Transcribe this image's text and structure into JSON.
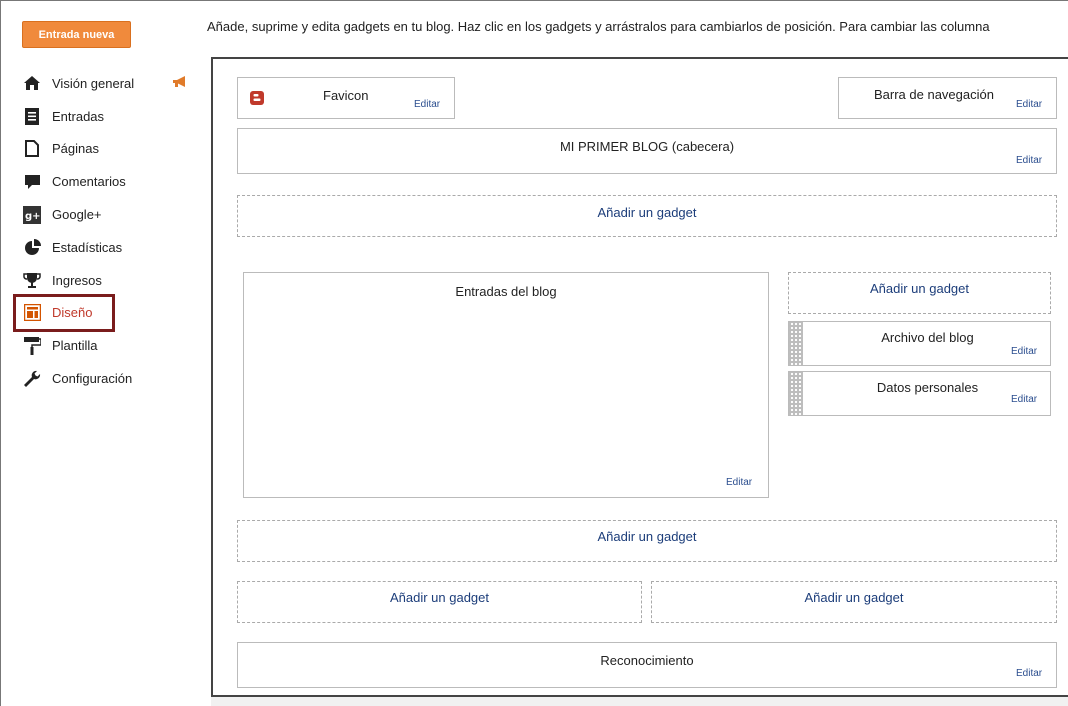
{
  "sidebar": {
    "new_post_label": "Entrada nueva",
    "items": [
      {
        "label": "Visión general",
        "icon": "home-icon"
      },
      {
        "label": "Entradas",
        "icon": "posts-icon"
      },
      {
        "label": "Páginas",
        "icon": "pages-icon"
      },
      {
        "label": "Comentarios",
        "icon": "comment-icon"
      },
      {
        "label": "Google+",
        "icon": "google-plus-icon"
      },
      {
        "label": "Estadísticas",
        "icon": "pie-chart-icon"
      },
      {
        "label": "Ingresos",
        "icon": "trophy-icon"
      },
      {
        "label": "Diseño",
        "icon": "layout-icon",
        "active": true
      },
      {
        "label": "Plantilla",
        "icon": "paint-roller-icon"
      },
      {
        "label": "Configuración",
        "icon": "wrench-icon"
      }
    ]
  },
  "main": {
    "description": "Añade, suprime y edita gadgets en tu blog. Haz clic en los gadgets y arrástralos para cambiarlos de posición. Para cambiar las columna",
    "edit_label": "Editar",
    "add_gadget_label": "Añadir un gadget",
    "gadgets": {
      "favicon": "Favicon",
      "navbar": "Barra de navegación",
      "header": "MI PRIMER BLOG (cabecera)",
      "blog_posts": "Entradas del blog",
      "archive": "Archivo del blog",
      "profile": "Datos personales",
      "attribution": "Reconocimiento"
    }
  },
  "colors": {
    "accent_orange": "#f08a3c",
    "active_outline": "#7a1c1c",
    "link_blue": "#1c3d7a"
  }
}
